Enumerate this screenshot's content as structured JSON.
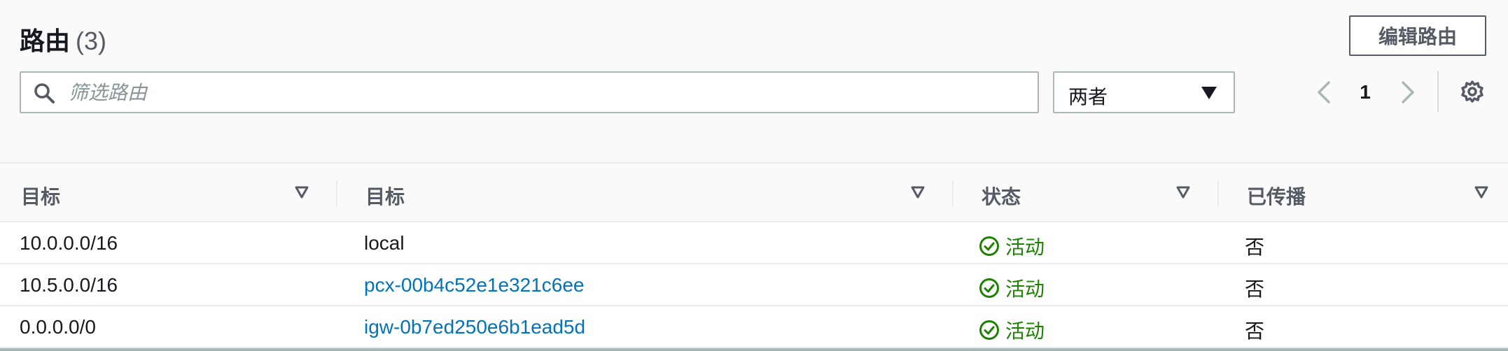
{
  "header": {
    "title": "路由",
    "count": "(3)",
    "edit_button": "编辑路由"
  },
  "filter": {
    "placeholder": "筛选路由",
    "value": "",
    "select_value": "两者"
  },
  "pagination": {
    "current_page": "1"
  },
  "table": {
    "columns": [
      "目标",
      "目标",
      "状态",
      "已传播"
    ],
    "rows": [
      {
        "destination": "10.0.0.0/16",
        "target": "local",
        "target_is_link": false,
        "status": "活动",
        "propagated": "否"
      },
      {
        "destination": "10.5.0.0/16",
        "target": "pcx-00b4c52e1e321c6ee",
        "target_is_link": true,
        "status": "活动",
        "propagated": "否"
      },
      {
        "destination": "0.0.0.0/0",
        "target": "igw-0b7ed250e6b1ead5d",
        "target_is_link": true,
        "status": "活动",
        "propagated": "否"
      }
    ]
  },
  "colors": {
    "link": "#0073bb",
    "status_active": "#1d8102",
    "text": "#16191f",
    "muted": "#545b64",
    "border": "#aab7b8"
  },
  "icons": {
    "search": "search-icon",
    "caret": "caret-down-icon",
    "prev": "chevron-left-icon",
    "next": "chevron-right-icon",
    "settings": "gear-icon",
    "sort": "sort-down-icon",
    "status": "check-circle-icon"
  }
}
